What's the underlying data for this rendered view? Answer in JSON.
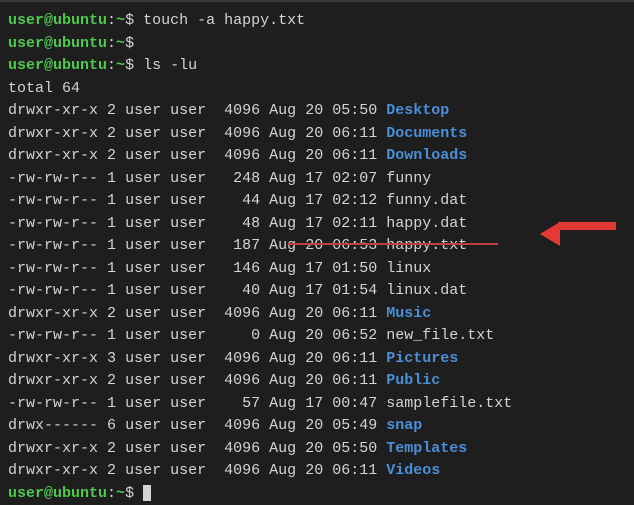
{
  "prompt": {
    "user": "user@ubuntu",
    "sep": ":",
    "path": "~",
    "dollar": "$"
  },
  "cmds": {
    "touch": " touch -a happy.txt",
    "empty": "",
    "ls": " ls -lu"
  },
  "total": "total 64",
  "rows": [
    {
      "perm": "drwxr-xr-x",
      "links": "2",
      "owner": "user",
      "group": "user",
      "size": "4096",
      "month": "Aug",
      "day": "20",
      "time": "05:50",
      "name": "Desktop",
      "isdir": true
    },
    {
      "perm": "drwxr-xr-x",
      "links": "2",
      "owner": "user",
      "group": "user",
      "size": "4096",
      "month": "Aug",
      "day": "20",
      "time": "06:11",
      "name": "Documents",
      "isdir": true
    },
    {
      "perm": "drwxr-xr-x",
      "links": "2",
      "owner": "user",
      "group": "user",
      "size": "4096",
      "month": "Aug",
      "day": "20",
      "time": "06:11",
      "name": "Downloads",
      "isdir": true
    },
    {
      "perm": "-rw-rw-r--",
      "links": "1",
      "owner": "user",
      "group": "user",
      "size": "248",
      "month": "Aug",
      "day": "17",
      "time": "02:07",
      "name": "funny",
      "isdir": false
    },
    {
      "perm": "-rw-rw-r--",
      "links": "1",
      "owner": "user",
      "group": "user",
      "size": "44",
      "month": "Aug",
      "day": "17",
      "time": "02:12",
      "name": "funny.dat",
      "isdir": false
    },
    {
      "perm": "-rw-rw-r--",
      "links": "1",
      "owner": "user",
      "group": "user",
      "size": "48",
      "month": "Aug",
      "day": "17",
      "time": "02:11",
      "name": "happy.dat",
      "isdir": false
    },
    {
      "perm": "-rw-rw-r--",
      "links": "1",
      "owner": "user",
      "group": "user",
      "size": "187",
      "month": "Aug",
      "day": "20",
      "time": "06:53",
      "name": "happy.txt",
      "isdir": false
    },
    {
      "perm": "-rw-rw-r--",
      "links": "1",
      "owner": "user",
      "group": "user",
      "size": "146",
      "month": "Aug",
      "day": "17",
      "time": "01:50",
      "name": "linux",
      "isdir": false
    },
    {
      "perm": "-rw-rw-r--",
      "links": "1",
      "owner": "user",
      "group": "user",
      "size": "40",
      "month": "Aug",
      "day": "17",
      "time": "01:54",
      "name": "linux.dat",
      "isdir": false
    },
    {
      "perm": "drwxr-xr-x",
      "links": "2",
      "owner": "user",
      "group": "user",
      "size": "4096",
      "month": "Aug",
      "day": "20",
      "time": "06:11",
      "name": "Music",
      "isdir": true
    },
    {
      "perm": "-rw-rw-r--",
      "links": "1",
      "owner": "user",
      "group": "user",
      "size": "0",
      "month": "Aug",
      "day": "20",
      "time": "06:52",
      "name": "new_file.txt",
      "isdir": false
    },
    {
      "perm": "drwxr-xr-x",
      "links": "3",
      "owner": "user",
      "group": "user",
      "size": "4096",
      "month": "Aug",
      "day": "20",
      "time": "06:11",
      "name": "Pictures",
      "isdir": true
    },
    {
      "perm": "drwxr-xr-x",
      "links": "2",
      "owner": "user",
      "group": "user",
      "size": "4096",
      "month": "Aug",
      "day": "20",
      "time": "06:11",
      "name": "Public",
      "isdir": true
    },
    {
      "perm": "-rw-rw-r--",
      "links": "1",
      "owner": "user",
      "group": "user",
      "size": "57",
      "month": "Aug",
      "day": "17",
      "time": "00:47",
      "name": "samplefile.txt",
      "isdir": false
    },
    {
      "perm": "drwx------",
      "links": "6",
      "owner": "user",
      "group": "user",
      "size": "4096",
      "month": "Aug",
      "day": "20",
      "time": "05:49",
      "name": "snap",
      "isdir": true
    },
    {
      "perm": "drwxr-xr-x",
      "links": "2",
      "owner": "user",
      "group": "user",
      "size": "4096",
      "month": "Aug",
      "day": "20",
      "time": "05:50",
      "name": "Templates",
      "isdir": true
    },
    {
      "perm": "drwxr-xr-x",
      "links": "2",
      "owner": "user",
      "group": "user",
      "size": "4096",
      "month": "Aug",
      "day": "20",
      "time": "06:11",
      "name": "Videos",
      "isdir": true
    }
  ]
}
